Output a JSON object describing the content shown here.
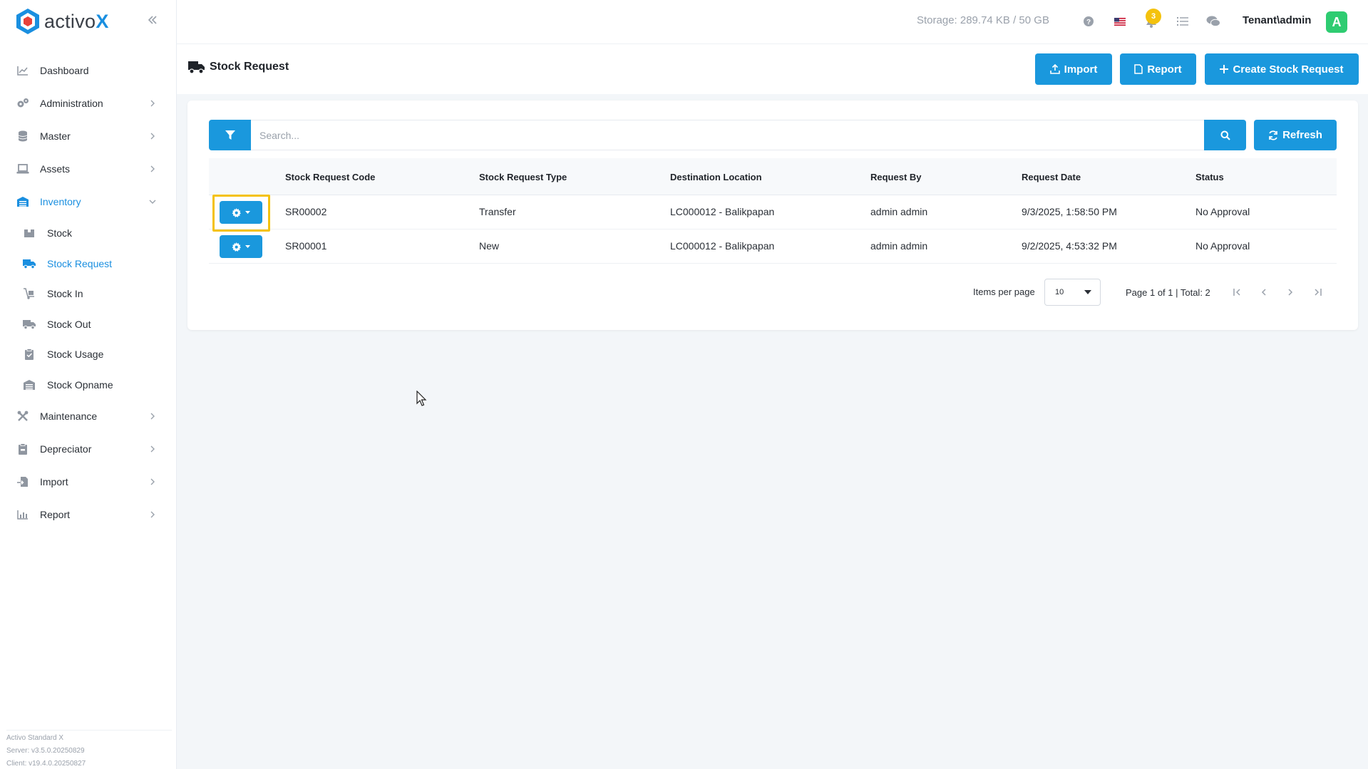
{
  "brand": {
    "name": "activo",
    "suffix": "X"
  },
  "sidebar": {
    "items": [
      {
        "label": "Dashboard",
        "icon": "chart-line-icon"
      },
      {
        "label": "Administration",
        "icon": "gears-icon"
      },
      {
        "label": "Master",
        "icon": "database-icon"
      },
      {
        "label": "Assets",
        "icon": "laptop-icon"
      },
      {
        "label": "Inventory",
        "icon": "warehouse-icon"
      },
      {
        "label": "Maintenance",
        "icon": "tools-icon"
      },
      {
        "label": "Depreciator",
        "icon": "clipboard-icon"
      },
      {
        "label": "Import",
        "icon": "file-import-icon"
      },
      {
        "label": "Report",
        "icon": "bar-chart-icon"
      }
    ],
    "inventory_sub": [
      {
        "label": "Stock",
        "icon": "box-icon"
      },
      {
        "label": "Stock Request",
        "icon": "truck-icon"
      },
      {
        "label": "Stock In",
        "icon": "dolly-icon"
      },
      {
        "label": "Stock Out",
        "icon": "truck-moving-icon"
      },
      {
        "label": "Stock Usage",
        "icon": "clipboard-check-icon"
      },
      {
        "label": "Stock Opname",
        "icon": "warehouse-icon"
      }
    ],
    "footer": [
      "Activo Standard X",
      "Server: v3.5.0.20250829",
      "Client: v19.4.0.20250827"
    ]
  },
  "topbar": {
    "storage": "Storage: 289.74 KB / 50 GB",
    "notification_count": "3",
    "user": "Tenant\\admin",
    "avatar_letter": "A"
  },
  "page": {
    "title": "Stock Request",
    "buttons": {
      "import": "Import",
      "report": "Report",
      "create": "Create Stock Request"
    }
  },
  "search": {
    "placeholder": "Search...",
    "refresh": "Refresh"
  },
  "table": {
    "headers": [
      "Stock Request Code",
      "Stock Request Type",
      "Destination Location",
      "Request By",
      "Request Date",
      "Status"
    ],
    "rows": [
      [
        "SR00002",
        "Transfer",
        "LC000012 - Balikpapan",
        "admin admin",
        "9/3/2025, 1:58:50 PM",
        "No Approval"
      ],
      [
        "SR00001",
        "New",
        "LC000012 - Balikpapan",
        "admin admin",
        "9/2/2025, 4:53:32 PM",
        "No Approval"
      ]
    ]
  },
  "pagination": {
    "items_per_page_label": "Items per page",
    "items_per_page_value": "10",
    "summary": "Page 1 of 1 | Total: 2"
  },
  "colors": {
    "accent": "#1a98dd",
    "highlight": "#f4c20d",
    "avatar": "#2ecc71"
  }
}
